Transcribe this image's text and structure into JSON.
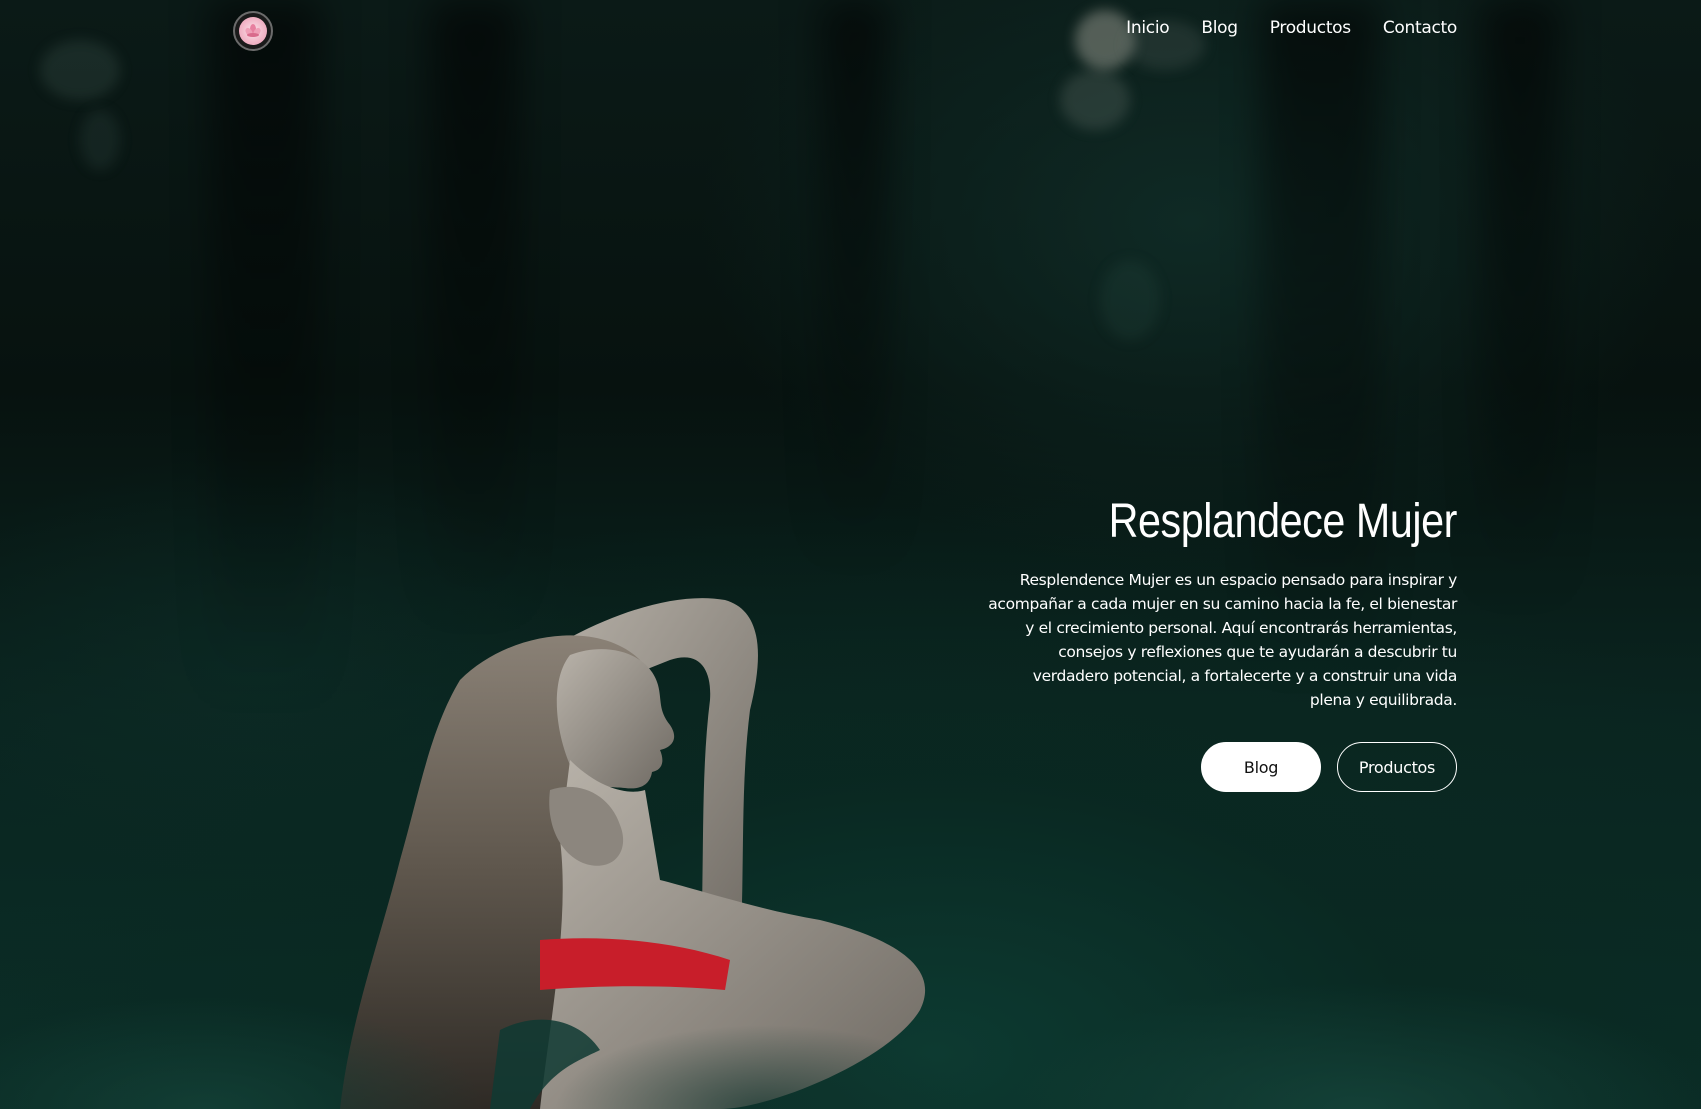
{
  "brand": {
    "logo_icon": "lotus-flower-logo"
  },
  "nav": {
    "items": [
      {
        "label": "Inicio"
      },
      {
        "label": "Blog"
      },
      {
        "label": "Productos"
      },
      {
        "label": "Contacto"
      }
    ]
  },
  "hero": {
    "title": "Resplandece Mujer",
    "description": "Resplendence Mujer es un espacio pensado para inspirar y acompañar a cada mujer en su camino hacia la fe, el bienestar y el crecimiento personal. Aquí encontrarás herramientas, consejos y reflexiones que te ayudarán a descubrir tu verdadero potencial, a fortalecerte y a construir una vida plena y equilibrada.",
    "buttons": {
      "primary_label": "Blog",
      "secondary_label": "Productos"
    }
  },
  "colors": {
    "background": "#07120f",
    "forest_green": "#0d3a31",
    "text": "#ffffff",
    "button_primary_bg": "#ffffff",
    "button_primary_text": "#111111",
    "dress_red": "#c81e2a"
  }
}
